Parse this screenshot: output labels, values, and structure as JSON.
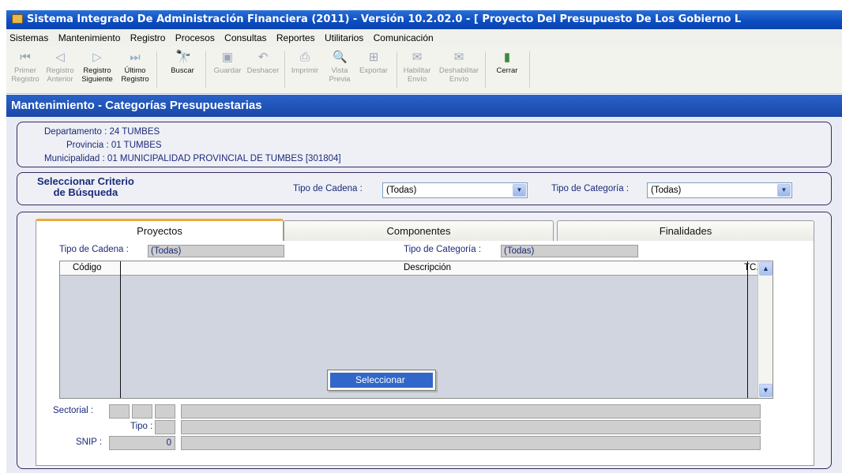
{
  "window": {
    "title": "Sistema Integrado De Administración Financiera (2011) - Versión 10.2.02.0 - [ Proyecto Del Presupuesto De Los Gobierno L"
  },
  "menu": [
    "Sistemas",
    "Mantenimiento",
    "Registro",
    "Procesos",
    "Consultas",
    "Reportes",
    "Utilitarios",
    "Comunicación"
  ],
  "toolbar": {
    "primer": [
      "Primer",
      "Registro"
    ],
    "anterior": [
      "Registro",
      "Anterior"
    ],
    "siguiente": [
      "Registro",
      "Siguiente"
    ],
    "ultimo": [
      "Último",
      "Registro"
    ],
    "buscar": "Buscar",
    "guardar": "Guardar",
    "deshacer": "Deshacer",
    "imprimir": "Imprimir",
    "vista": [
      "Vista",
      "Previa"
    ],
    "exportar": "Exportar",
    "habilitar": [
      "Habilitar",
      "Envío"
    ],
    "deshabilitar": [
      "Deshabilitar",
      "Envío"
    ],
    "cerrar": "Cerrar"
  },
  "panel": {
    "title": "Mantenimiento - Categorías Presupuestarias"
  },
  "info": {
    "departamento_label": "Departamento :",
    "departamento_value": "24  TUMBES",
    "provincia_label": "Provincia :",
    "provincia_value": "01  TUMBES",
    "municipalidad_label": "Municipalidad :",
    "municipalidad_value": "01  MUNICIPALIDAD PROVINCIAL DE TUMBES [301804]"
  },
  "criteria": {
    "title_line1": "Seleccionar Criterio",
    "title_line2": "de Búsqueda",
    "cadena_label": "Tipo de Cadena :",
    "cadena_value": "(Todas)",
    "categoria_label": "Tipo de Categoría :",
    "categoria_value": "(Todas)"
  },
  "tabs": [
    "Proyectos",
    "Componentes",
    "Finalidades"
  ],
  "tab_content": {
    "cadena_label": "Tipo de Cadena :",
    "cadena_value": "(Todas)",
    "categoria_label": "Tipo de Categoría :",
    "categoria_value": "(Todas)"
  },
  "grid": {
    "columns": [
      "Código",
      "Descripción",
      "TC."
    ]
  },
  "popup": {
    "seleccionar": "Seleccionar"
  },
  "footer": {
    "sectorial_label": "Sectorial :",
    "tipo_label": "Tipo :",
    "snip_label": "SNIP :",
    "snip_value": "0"
  }
}
